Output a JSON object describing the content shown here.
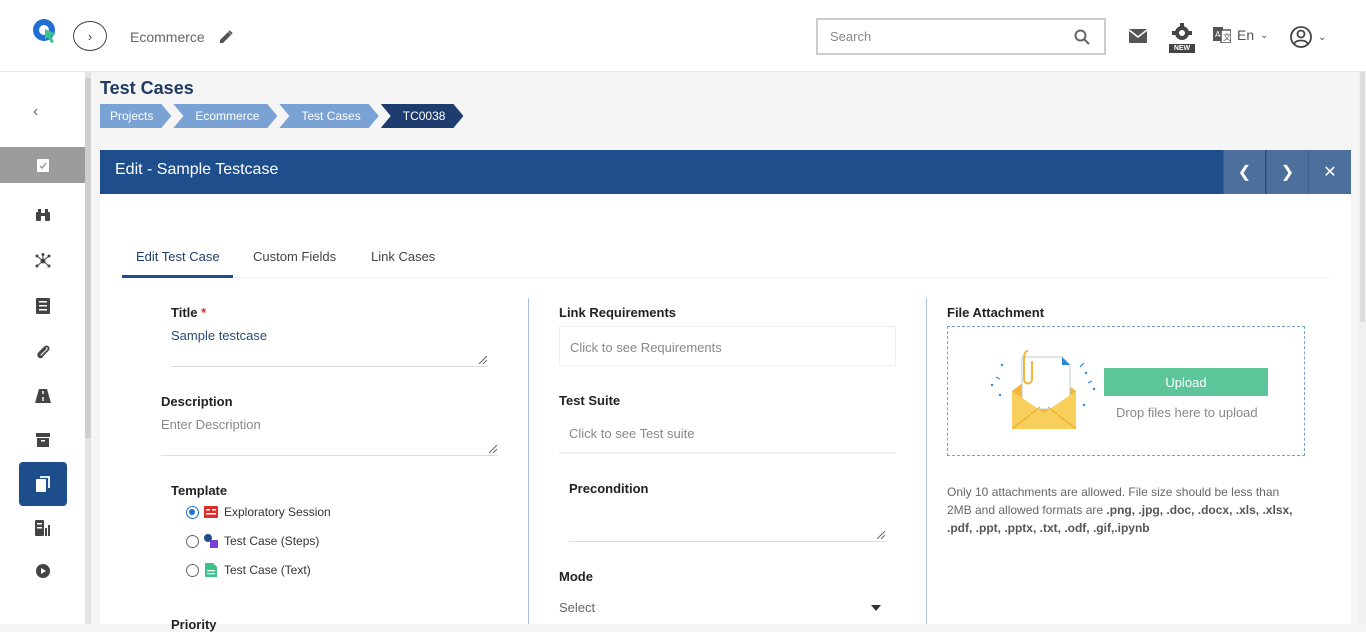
{
  "header": {
    "project_name": "Ecommerce",
    "search_placeholder": "Search",
    "language": "En",
    "new_badge": "NEW"
  },
  "page": {
    "title": "Test Cases",
    "breadcrumb": [
      "Projects",
      "Ecommerce",
      "Test Cases",
      "TC0038"
    ]
  },
  "panel": {
    "title": "Edit - Sample Testcase",
    "tabs": [
      "Edit Test Case",
      "Custom Fields",
      "Link Cases"
    ],
    "active_tab": "Edit Test Case"
  },
  "form": {
    "title_label": "Title",
    "title_required": "*",
    "title_value": "Sample testcase",
    "description_label": "Description",
    "description_placeholder": "Enter Description",
    "template_label": "Template",
    "templates": [
      {
        "label": "Exploratory Session",
        "checked": true
      },
      {
        "label": "Test Case (Steps)",
        "checked": false
      },
      {
        "label": "Test Case (Text)",
        "checked": false
      }
    ],
    "priority_label": "Priority",
    "link_requirements_label": "Link Requirements",
    "link_requirements_placeholder": "Click to see Requirements",
    "test_suite_label": "Test Suite",
    "test_suite_placeholder": "Click to see Test suite",
    "precondition_label": "Precondition",
    "mode_label": "Mode",
    "mode_value": "Select"
  },
  "attachment": {
    "label": "File Attachment",
    "upload_button": "Upload",
    "drop_text": "Drop files here to upload",
    "note_prefix": "Only 10 attachments are allowed. File size should be less than 2MB and allowed formats are ",
    "note_formats": ".png, .jpg, .doc, .docx, .xls, .xlsx, .pdf, .ppt, .pptx, .txt, .odf, .gif,.ipynb"
  },
  "colors": {
    "primary": "#1f4e8c",
    "breadcrumb": "#7aa2d4",
    "upload": "#5cc59a",
    "required": "#d9302c"
  }
}
